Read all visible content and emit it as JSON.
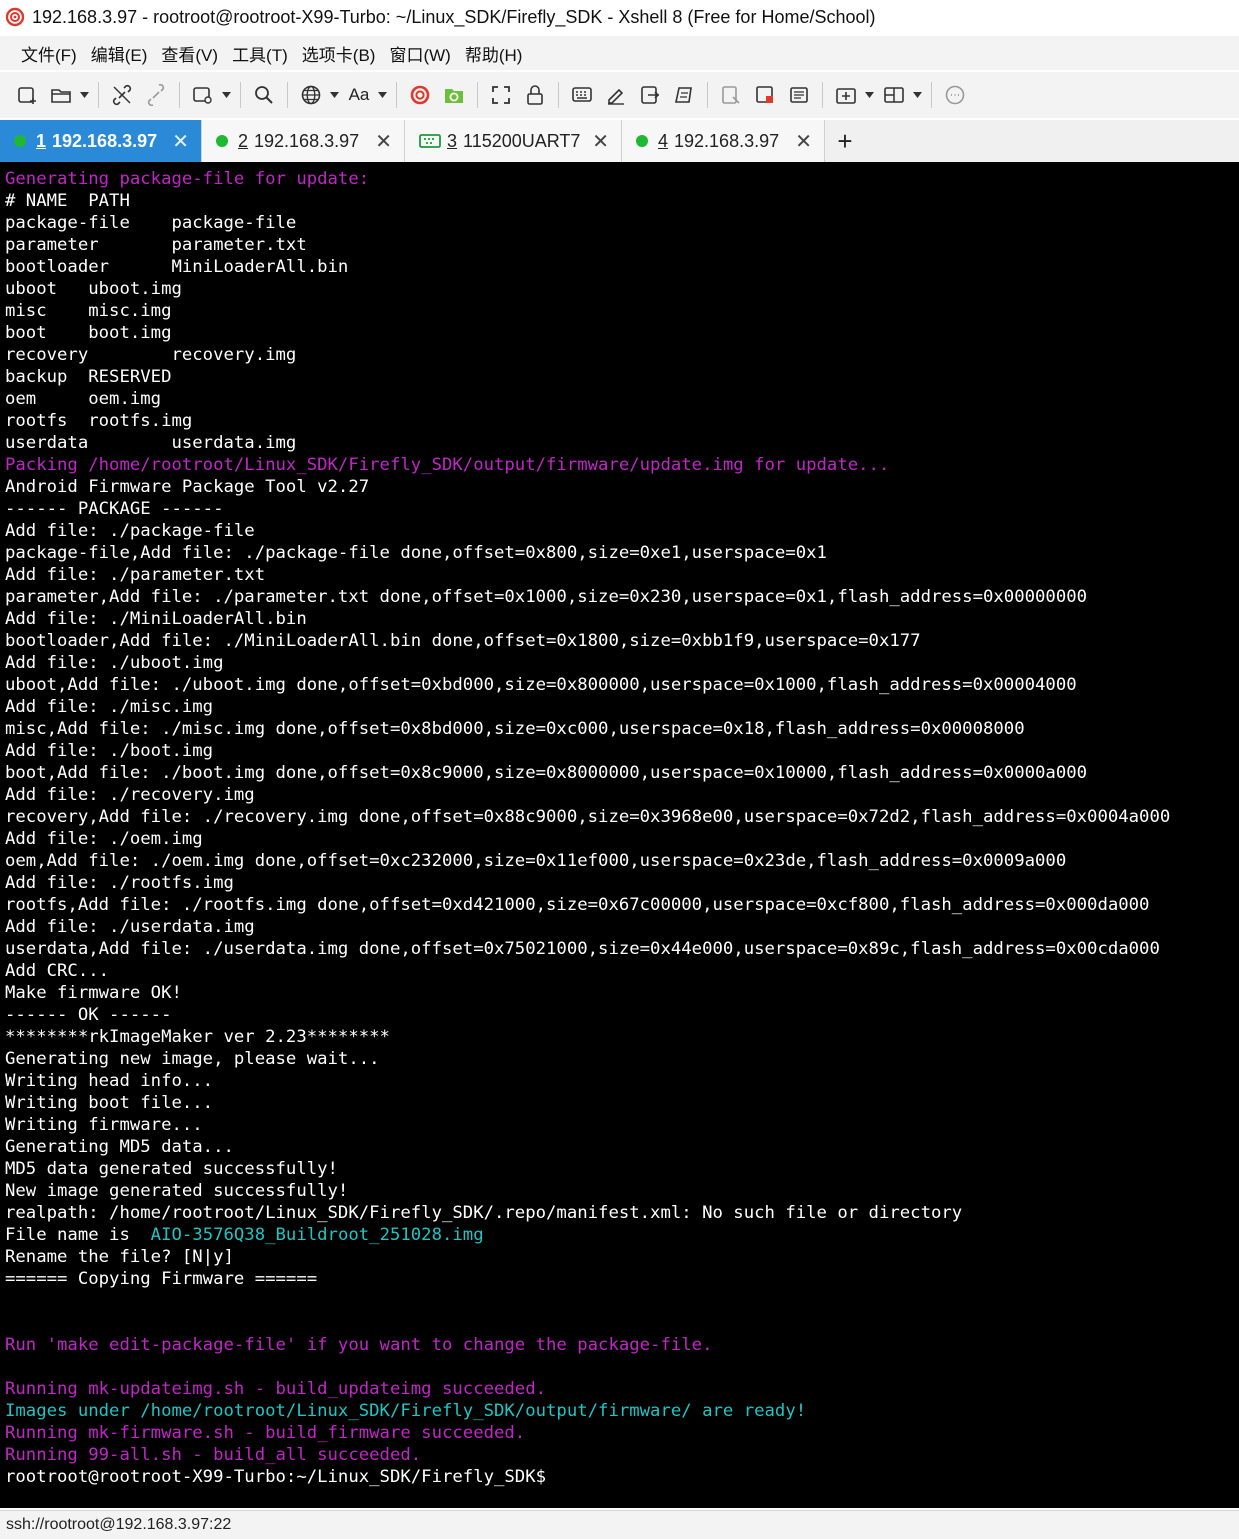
{
  "window": {
    "title": "192.168.3.97 - rootroot@rootroot-X99-Turbo: ~/Linux_SDK/Firefly_SDK - Xshell 8 (Free for Home/School)"
  },
  "menu": [
    "文件(F)",
    "编辑(E)",
    "查看(V)",
    "工具(T)",
    "选项卡(B)",
    "窗口(W)",
    "帮助(H)"
  ],
  "toolbar": {
    "font_label": "Aa",
    "icons": [
      "new-session-icon",
      "open-folder-icon",
      "disconnect-icon",
      "reconnect-icon",
      "new-window-icon",
      "search-icon",
      "globe-icon",
      "font-icon",
      "xshell-icon",
      "xftp-icon",
      "fullscreen-icon",
      "lock-icon",
      "keyboard-icon",
      "compose-icon",
      "script-icon",
      "transfer-icon",
      "log-icon",
      "screenshot-icon",
      "copy-icon",
      "add-tab-icon",
      "layout-icon",
      "chat-icon"
    ]
  },
  "tabs": [
    {
      "num": "1",
      "label": "192.168.3.97",
      "status": "connected",
      "active": true
    },
    {
      "num": "2",
      "label": "192.168.3.97",
      "status": "connected",
      "active": false
    },
    {
      "num": "3",
      "label": "115200UART7",
      "status": "serial",
      "active": false
    },
    {
      "num": "4",
      "label": "192.168.3.97",
      "status": "connected",
      "active": false
    }
  ],
  "tab_add_label": "+",
  "colors": {
    "magenta": "#c026c6",
    "cyan": "#1fc4c4",
    "white": "#ffffff",
    "active_tab": "#2b8ad8",
    "status_dot": "#1fb832"
  },
  "terminal": {
    "lines": [
      [
        {
          "t": "Generating package-file for update:",
          "c": "mag"
        }
      ],
      [
        {
          "t": "# NAME  PATH"
        }
      ],
      [
        {
          "t": "package-file    package-file"
        }
      ],
      [
        {
          "t": "parameter       parameter.txt"
        }
      ],
      [
        {
          "t": "bootloader      MiniLoaderAll.bin"
        }
      ],
      [
        {
          "t": "uboot   uboot.img"
        }
      ],
      [
        {
          "t": "misc    misc.img"
        }
      ],
      [
        {
          "t": "boot    boot.img"
        }
      ],
      [
        {
          "t": "recovery        recovery.img"
        }
      ],
      [
        {
          "t": "backup  RESERVED"
        }
      ],
      [
        {
          "t": "oem     oem.img"
        }
      ],
      [
        {
          "t": "rootfs  rootfs.img"
        }
      ],
      [
        {
          "t": "userdata        userdata.img"
        }
      ],
      [
        {
          "t": "Packing /home/rootroot/Linux_SDK/Firefly_SDK/output/firmware/update.img for update...",
          "c": "mag"
        }
      ],
      [
        {
          "t": "Android Firmware Package Tool v2.27"
        }
      ],
      [
        {
          "t": "------ PACKAGE ------"
        }
      ],
      [
        {
          "t": "Add file: ./package-file"
        }
      ],
      [
        {
          "t": "package-file,Add file: ./package-file done,offset=0x800,size=0xe1,userspace=0x1"
        }
      ],
      [
        {
          "t": "Add file: ./parameter.txt"
        }
      ],
      [
        {
          "t": "parameter,Add file: ./parameter.txt done,offset=0x1000,size=0x230,userspace=0x1,flash_address=0x00000000"
        }
      ],
      [
        {
          "t": "Add file: ./MiniLoaderAll.bin"
        }
      ],
      [
        {
          "t": "bootloader,Add file: ./MiniLoaderAll.bin done,offset=0x1800,size=0xbb1f9,userspace=0x177"
        }
      ],
      [
        {
          "t": "Add file: ./uboot.img"
        }
      ],
      [
        {
          "t": "uboot,Add file: ./uboot.img done,offset=0xbd000,size=0x800000,userspace=0x1000,flash_address=0x00004000"
        }
      ],
      [
        {
          "t": "Add file: ./misc.img"
        }
      ],
      [
        {
          "t": "misc,Add file: ./misc.img done,offset=0x8bd000,size=0xc000,userspace=0x18,flash_address=0x00008000"
        }
      ],
      [
        {
          "t": "Add file: ./boot.img"
        }
      ],
      [
        {
          "t": "boot,Add file: ./boot.img done,offset=0x8c9000,size=0x8000000,userspace=0x10000,flash_address=0x0000a000"
        }
      ],
      [
        {
          "t": "Add file: ./recovery.img"
        }
      ],
      [
        {
          "t": "recovery,Add file: ./recovery.img done,offset=0x88c9000,size=0x3968e00,userspace=0x72d2,flash_address=0x0004a000"
        }
      ],
      [
        {
          "t": "Add file: ./oem.img"
        }
      ],
      [
        {
          "t": "oem,Add file: ./oem.img done,offset=0xc232000,size=0x11ef000,userspace=0x23de,flash_address=0x0009a000"
        }
      ],
      [
        {
          "t": "Add file: ./rootfs.img"
        }
      ],
      [
        {
          "t": "rootfs,Add file: ./rootfs.img done,offset=0xd421000,size=0x67c00000,userspace=0xcf800,flash_address=0x000da000"
        }
      ],
      [
        {
          "t": "Add file: ./userdata.img"
        }
      ],
      [
        {
          "t": "userdata,Add file: ./userdata.img done,offset=0x75021000,size=0x44e000,userspace=0x89c,flash_address=0x00cda000"
        }
      ],
      [
        {
          "t": "Add CRC..."
        }
      ],
      [
        {
          "t": "Make firmware OK!"
        }
      ],
      [
        {
          "t": "------ OK ------"
        }
      ],
      [
        {
          "t": "********rkImageMaker ver 2.23********"
        }
      ],
      [
        {
          "t": "Generating new image, please wait..."
        }
      ],
      [
        {
          "t": "Writing head info..."
        }
      ],
      [
        {
          "t": "Writing boot file..."
        }
      ],
      [
        {
          "t": "Writing firmware..."
        }
      ],
      [
        {
          "t": "Generating MD5 data..."
        }
      ],
      [
        {
          "t": "MD5 data generated successfully!"
        }
      ],
      [
        {
          "t": "New image generated successfully!"
        }
      ],
      [
        {
          "t": "realpath: /home/rootroot/Linux_SDK/Firefly_SDK/.repo/manifest.xml: No such file or directory"
        }
      ],
      [
        {
          "t": "File name is  "
        },
        {
          "t": "AIO-3576Q38_Buildroot_251028.img",
          "c": "cyan"
        }
      ],
      [
        {
          "t": "Rename the file? [N|y]"
        }
      ],
      [
        {
          "t": "====== Copying Firmware ======"
        }
      ],
      [
        {
          "t": ""
        }
      ],
      [
        {
          "t": ""
        }
      ],
      [
        {
          "t": "Run 'make edit-package-file' if you want to change the package-file.",
          "c": "mag"
        }
      ],
      [
        {
          "t": ""
        }
      ],
      [
        {
          "t": "Running mk-updateimg.sh - build_updateimg succeeded.",
          "c": "mag"
        }
      ],
      [
        {
          "t": "Images under /home/rootroot/Linux_SDK/Firefly_SDK/output/firmware/ are ready!",
          "c": "cyan"
        }
      ],
      [
        {
          "t": "Running mk-firmware.sh - build_firmware succeeded.",
          "c": "mag"
        }
      ],
      [
        {
          "t": "Running 99-all.sh - build_all succeeded.",
          "c": "mag"
        }
      ],
      [
        {
          "t": "rootroot@rootroot-X99-Turbo:~/Linux_SDK/Firefly_SDK$"
        }
      ]
    ]
  },
  "status": {
    "text": "ssh://rootroot@192.168.3.97:22"
  }
}
